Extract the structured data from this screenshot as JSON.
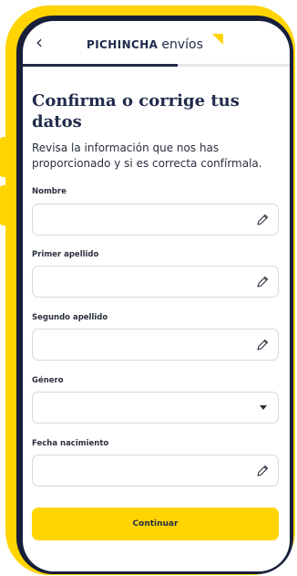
{
  "header": {
    "back_icon": "chevron-left-icon",
    "back_glyph": "‹",
    "brand_bold": "PICHINCHA",
    "brand_light": "envíos",
    "progress_fraction": 0.58
  },
  "main": {
    "title": "Confirma o corrige tus datos",
    "subtitle": "Revisa la información que nos has proporcionado y si es correcta confírmala."
  },
  "form": {
    "fields": [
      {
        "label": "Nombre",
        "value": "",
        "icon": "edit-pencil-icon"
      },
      {
        "label": "Primer apellido",
        "value": "",
        "icon": "edit-pencil-icon"
      },
      {
        "label": "Segundo apellido",
        "value": "",
        "icon": "edit-pencil-icon"
      },
      {
        "label": "Género",
        "value": "",
        "icon": "chevron-down-icon"
      },
      {
        "label": "Fecha nacimiento",
        "value": "",
        "icon": "edit-pencil-icon"
      }
    ],
    "submit_label": "Continuar"
  },
  "colors": {
    "brand_yellow": "#ffd400",
    "brand_navy": "#1f2b4a",
    "frame_dark": "#171f3a"
  }
}
